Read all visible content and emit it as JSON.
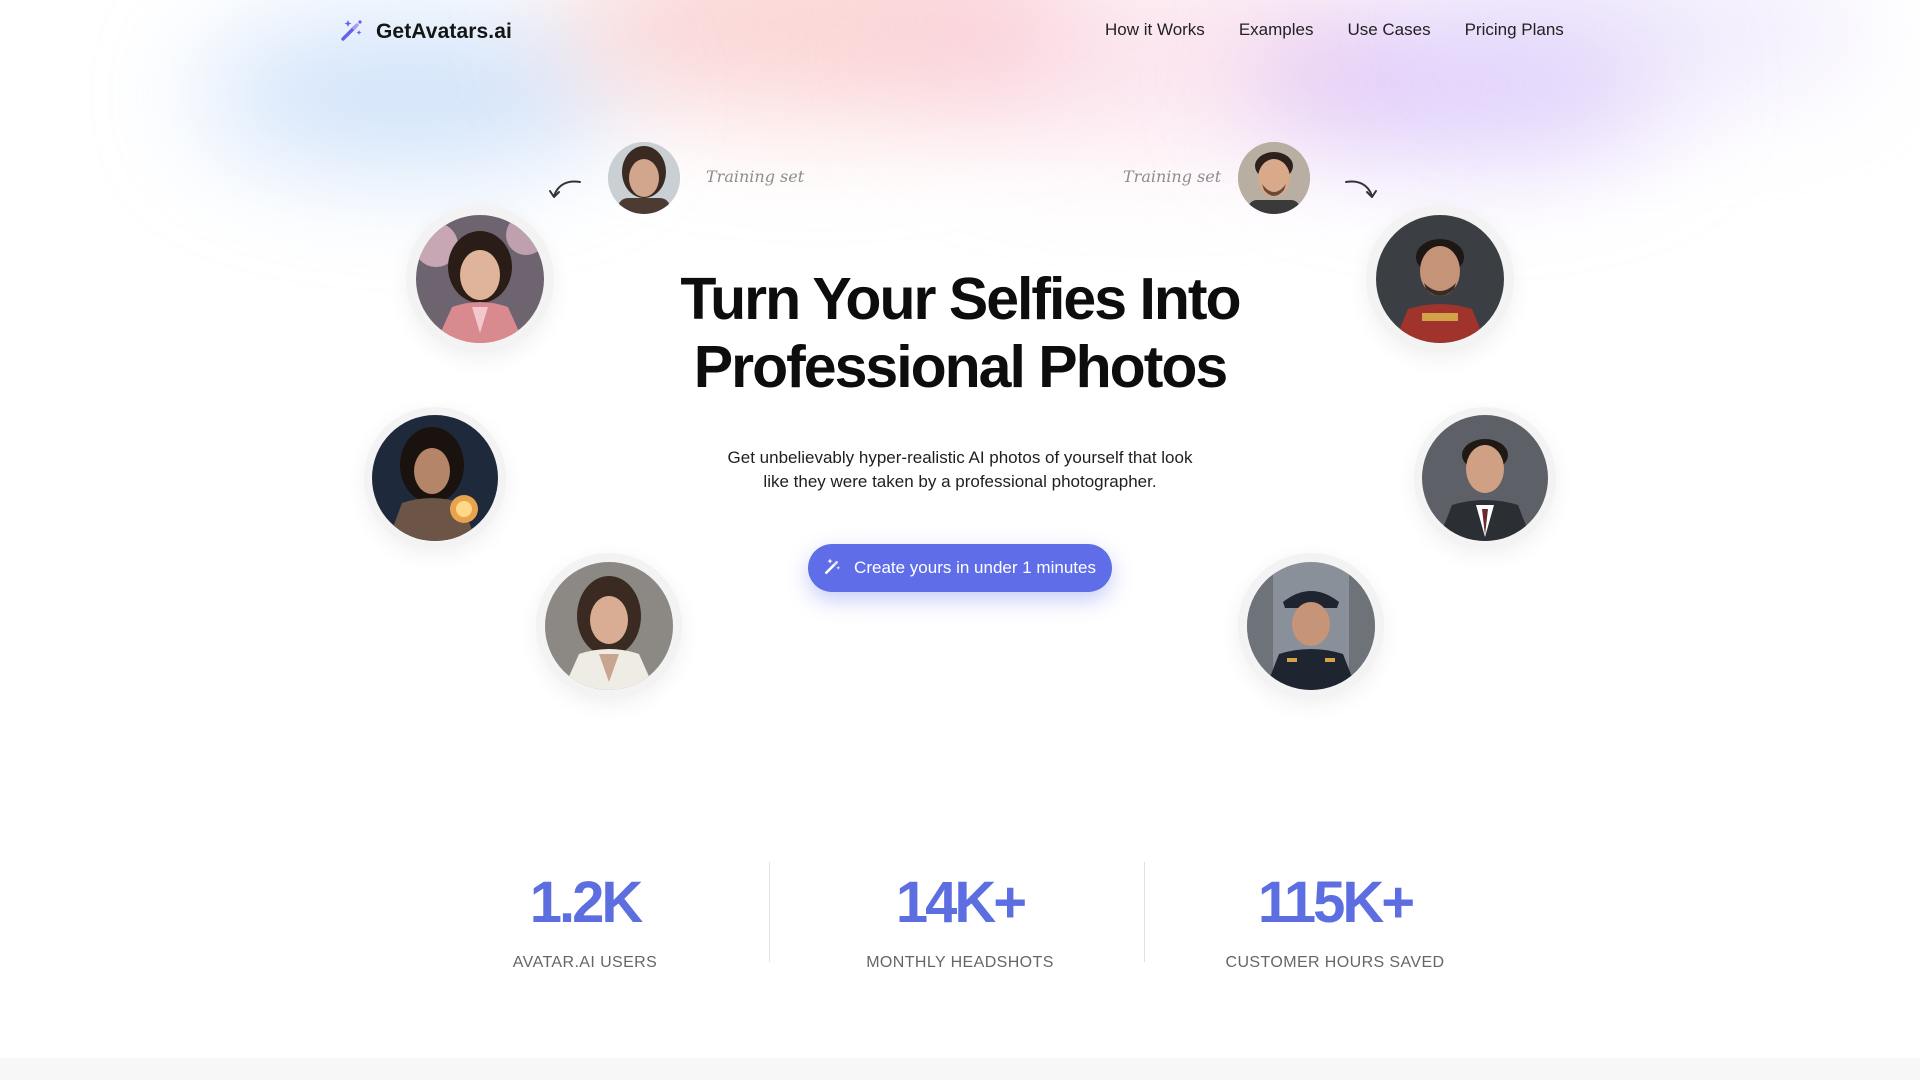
{
  "brand": {
    "name": "GetAvatars.ai",
    "icon": "magic-wand-icon"
  },
  "nav": {
    "items": [
      "How it Works",
      "Examples",
      "Use Cases",
      "Pricing Plans"
    ]
  },
  "training": {
    "left_label": "Training set",
    "right_label": "Training set"
  },
  "hero": {
    "headline_line1": "Turn Your Selfies Into",
    "headline_line2": "Professional Photos",
    "subtitle_line1": "Get unbelievably hyper-realistic AI photos of yourself that look",
    "subtitle_line2": "like they were taken by a professional photographer.",
    "cta_label": "Create yours in under 1 minutes",
    "cta_icon": "magic-wand-icon"
  },
  "stats": [
    {
      "value": "1.2K",
      "label": "AVATAR.AI USERS"
    },
    {
      "value": "14K+",
      "label": "MONTHLY HEADSHOTS"
    },
    {
      "value": "115K+",
      "label": "CUSTOMER HOURS SAVED"
    }
  ],
  "colors": {
    "accent": "#5f6ee8",
    "stat_number": "#5c6ee0",
    "heading": "#0d0d0d"
  }
}
